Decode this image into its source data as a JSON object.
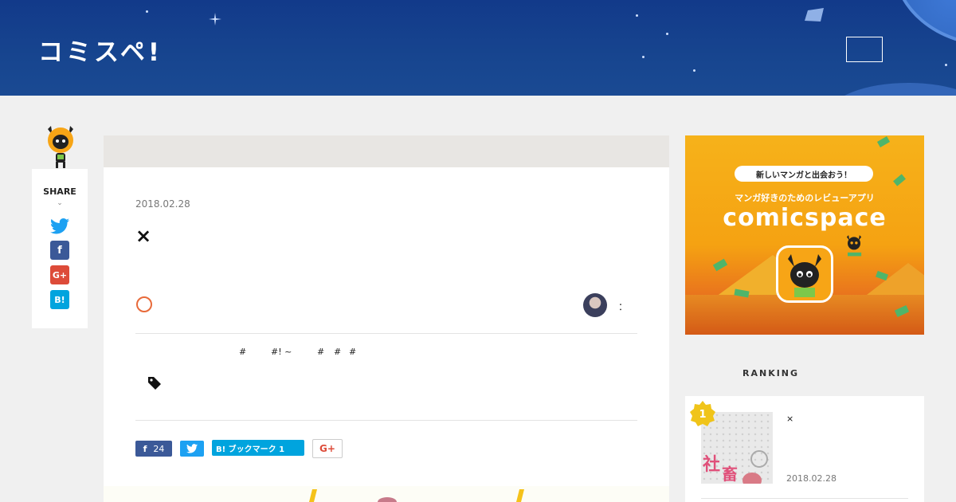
{
  "header": {
    "logo_text": "コミスペ!",
    "menu_button": "",
    "menu_label": ""
  },
  "share": {
    "title": "SHARE",
    "chevron": "⌄",
    "buttons": [
      {
        "name": "twitter",
        "glyph": "",
        "color": "#1da1f2"
      },
      {
        "name": "facebook",
        "glyph": "f",
        "color": "#3b5998"
      },
      {
        "name": "google-plus",
        "glyph": "G+",
        "color": "#dd4b39"
      },
      {
        "name": "hatena",
        "glyph": "B!",
        "color": "#00a4de"
      }
    ]
  },
  "article": {
    "breadcrumb": "",
    "date": "2018.02.28",
    "title": " ×",
    "author": "：",
    "tags": [
      "#",
      "#! ~",
      "#",
      "#",
      "#"
    ],
    "social": {
      "fb_count": "24",
      "hatena_label": "B! ブックマーク 1",
      "gplus": "G+"
    }
  },
  "ad": {
    "pill": "新しいマンガと出会おう！",
    "subtitle": "マンガ好きのためのレビューアプリ",
    "brand": "comicspace"
  },
  "ranking": {
    "heading": "",
    "heading_en": "RANKING",
    "items": [
      {
        "rank": "1",
        "title": " ×",
        "date": "2018.02.28"
      }
    ]
  },
  "colors": {
    "header_blue": "#17458f",
    "accent_orange": "#e86a3a",
    "facebook": "#3b5998",
    "twitter": "#1da1f2",
    "hatena": "#00a4de",
    "ad_orange": "#f5a212"
  }
}
